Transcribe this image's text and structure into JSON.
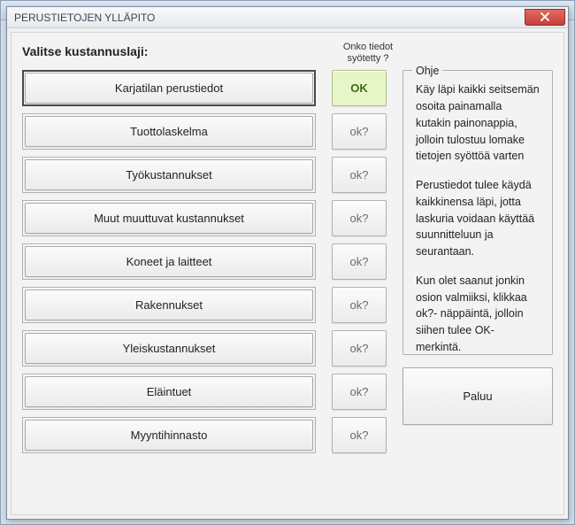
{
  "window": {
    "title": "PERUSTIETOJEN YLLÄPITO"
  },
  "prompt": "Valitse kustannuslaji:",
  "status_header_line1": "Onko tiedot",
  "status_header_line2": "syötetty ?",
  "ohje": {
    "legend": "Ohje",
    "p1": "Käy läpi kaikki seitsemän osoita painamalla kutakin painonappia, jolloin tulostuu lomake tietojen syöttöä varten",
    "p2": "Perustiedot tulee käydä kaikkinensa läpi, jotta laskuria voidaan käyttää suunnitteluun ja seurantaan.",
    "p3": "Kun olet saanut jonkin osion valmiiksi, klikkaa ok?- näppäintä, jolloin siihen tulee OK- merkintä."
  },
  "items": [
    {
      "label": "Karjatilan perustiedot",
      "status": "OK",
      "selected": true
    },
    {
      "label": "Tuottolaskelma",
      "status": "ok?",
      "selected": false
    },
    {
      "label": "Työkustannukset",
      "status": "ok?",
      "selected": false
    },
    {
      "label": "Muut muuttuvat kustannukset",
      "status": "ok?",
      "selected": false
    },
    {
      "label": "Koneet ja laitteet",
      "status": "ok?",
      "selected": false
    },
    {
      "label": "Rakennukset",
      "status": "ok?",
      "selected": false
    },
    {
      "label": "Yleiskustannukset",
      "status": "ok?",
      "selected": false
    },
    {
      "label": "Eläintuet",
      "status": "ok?",
      "selected": false
    },
    {
      "label": "Myyntihinnasto",
      "status": "ok?",
      "selected": false
    }
  ],
  "paluu_label": "Paluu"
}
